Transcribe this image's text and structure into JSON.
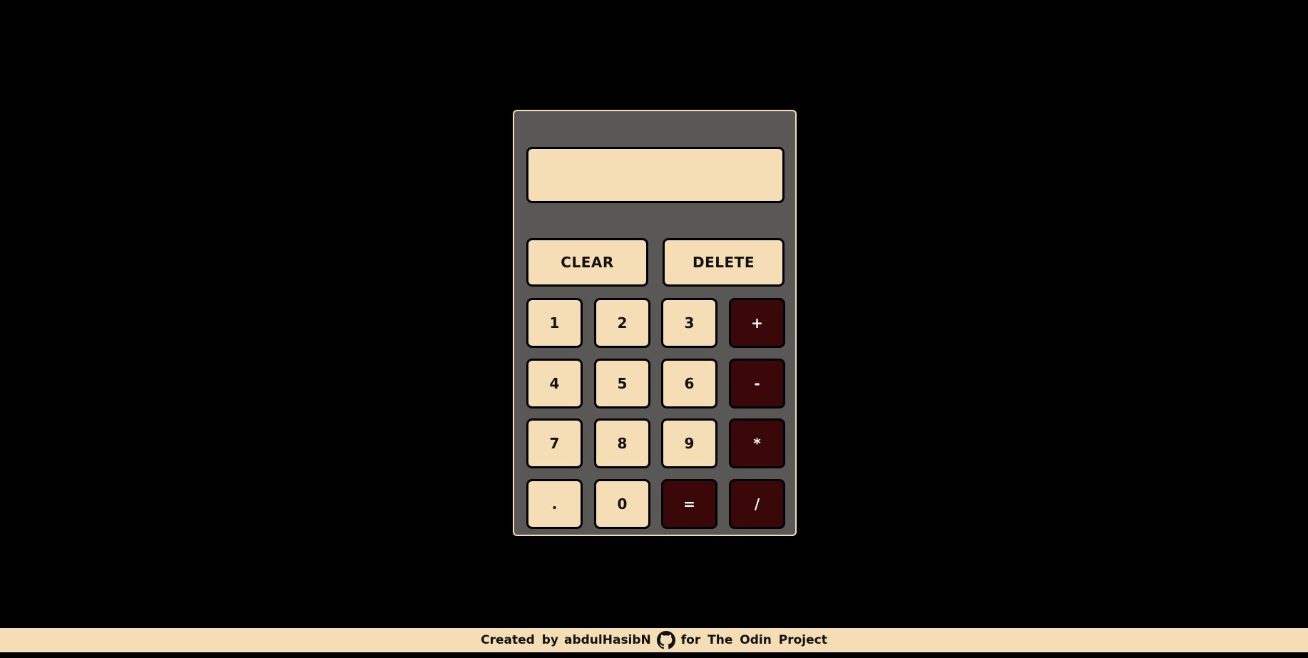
{
  "display": {
    "value": ""
  },
  "controls": {
    "clear": "CLEAR",
    "delete": "DELETE"
  },
  "keys": [
    {
      "label": "1",
      "style": "light"
    },
    {
      "label": "2",
      "style": "light"
    },
    {
      "label": "3",
      "style": "light"
    },
    {
      "label": "+",
      "style": "dark"
    },
    {
      "label": "4",
      "style": "light"
    },
    {
      "label": "5",
      "style": "light"
    },
    {
      "label": "6",
      "style": "light"
    },
    {
      "label": "-",
      "style": "dark"
    },
    {
      "label": "7",
      "style": "light"
    },
    {
      "label": "8",
      "style": "light"
    },
    {
      "label": "9",
      "style": "light"
    },
    {
      "label": "*",
      "style": "dark"
    },
    {
      "label": ".",
      "style": "light"
    },
    {
      "label": "0",
      "style": "light"
    },
    {
      "label": "=",
      "style": "dark"
    },
    {
      "label": "/",
      "style": "dark"
    }
  ],
  "footer": {
    "created_by": "Created by",
    "author": "abdulHasibN",
    "icon": "github-icon",
    "for_text": "for The Odin Project"
  },
  "colors": {
    "background": "#000000",
    "body": "#5a5757",
    "cream": "#f5ddb5",
    "operator": "#3a0808"
  }
}
